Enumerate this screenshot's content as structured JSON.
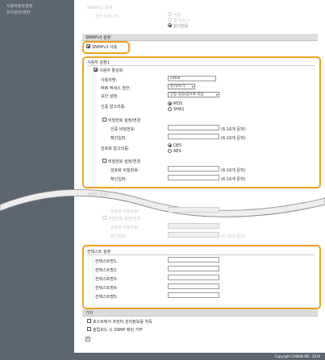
{
  "sidebar": {
    "items": [
      "사용자정보설정",
      "유지관리/권한"
    ]
  },
  "top_section": {
    "title": "SNMPv1 설정",
    "label": "관리 커뮤니티:",
    "options": [
      "사용",
      "읽기/쓰기",
      "읽기전용"
    ]
  },
  "snmpv3": {
    "header": "SNMPv3 설정",
    "enable_label": "SNMPv3 사용"
  },
  "user_settings_1": {
    "header": "사용자 설정1",
    "enable_user_label": "사용자 활성화",
    "username_label": "사용자명:",
    "username_value": "initial",
    "mib_access_label": "MIB 액세스 권한:",
    "mib_access_value": "읽기/쓰기",
    "security_label": "보안 설정:",
    "security_value": "인증 있음/암호화 있음",
    "auth_algo_label": "인증 알고리즘:",
    "auth_options": [
      "MD5",
      "SHA1"
    ],
    "set_auth_pw_label": "비밀번호 설정/변경",
    "auth_pw_label": "인증 비밀번호:",
    "confirm_label": "확인입력:",
    "hint": "(6-16개 문자)",
    "enc_algo_label": "암호화 알고리즘:",
    "enc_options": [
      "DES",
      "AES"
    ],
    "set_enc_pw_label": "비밀번호 설정/변경",
    "enc_pw_label": "암호화 비밀번호:",
    "confirm2_label": "확인입력:"
  },
  "user_settings_2": {
    "header": "사용자 설정2",
    "enc_pw_label": "암호화 비밀번호:",
    "set_pw_label": "비밀번호 설정/변경",
    "enc_pw2_label": "암호화 비밀번호:",
    "confirm_label": "확인입력:",
    "hint": "(6-16개 문자)"
  },
  "context": {
    "header": "컨텍스트 설정",
    "labels": [
      "컨텍스트명1:",
      "컨텍스트명2:",
      "컨텍스트명3:",
      "컨텍스트명4:",
      "컨텍스트명5:"
    ]
  },
  "other": {
    "header": "기타",
    "option1": "호스트에서 프린터 관리정보를 취득",
    "option2": "슬립모드 시 SNMP 패킷 거부"
  },
  "footer": {
    "copyright": "Copyright CANON INC. 2019"
  },
  "colors": {
    "highlight": "#f2a11f",
    "sidebar": "#5b6671"
  }
}
